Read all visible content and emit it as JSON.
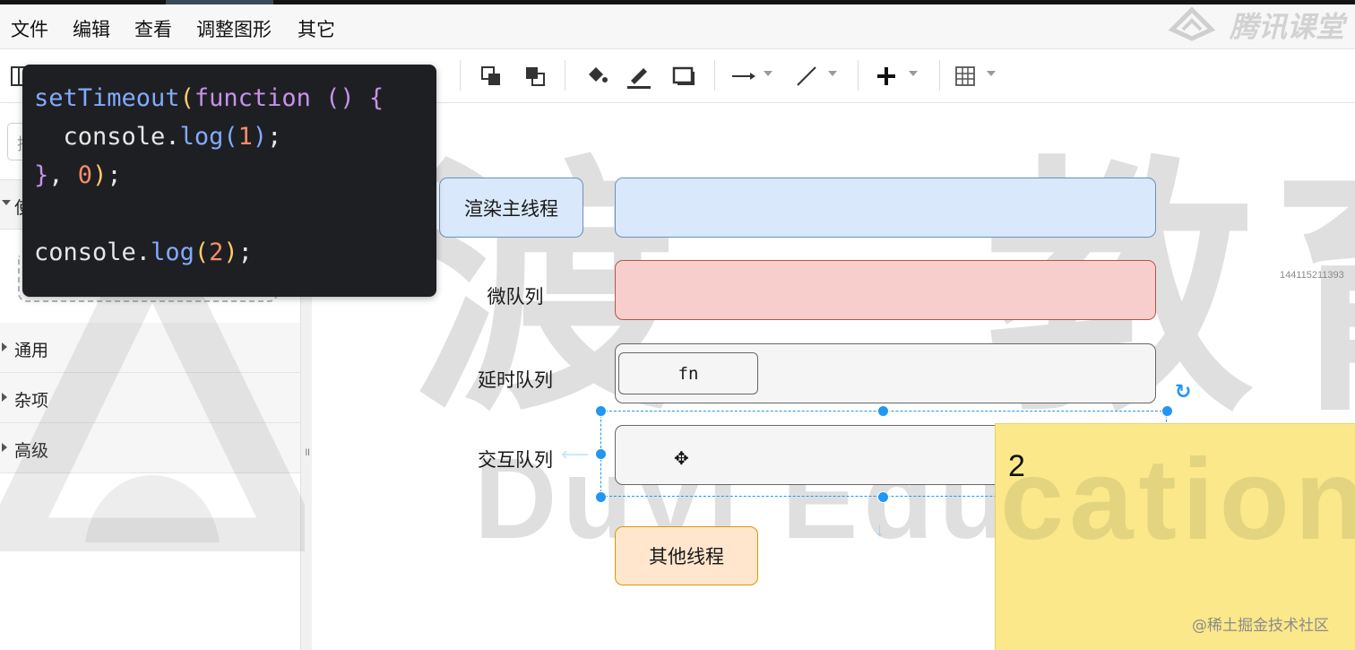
{
  "menubar": {
    "items": [
      "文件",
      "编辑",
      "查看",
      "调整图形",
      "其它"
    ]
  },
  "toolbar": {
    "icons": [
      "layout-icon",
      "to-front-icon",
      "to-back-icon",
      "fill-color-icon",
      "line-color-icon",
      "shadow-icon",
      "connection-arrow-icon",
      "waypoint-icon",
      "insert-plus-icon",
      "table-icon"
    ]
  },
  "sidebar": {
    "search_placeholder": "搜",
    "partial_section": "使",
    "sections": [
      "通用",
      "杂项",
      "高级"
    ]
  },
  "code": {
    "lines": [
      [
        "setTimeout",
        "(",
        "function",
        " ",
        "()",
        " ",
        "{"
      ],
      [
        "  console",
        ".",
        "log",
        "(",
        "1",
        ")",
        ";"
      ],
      [
        "}",
        ",",
        " ",
        "0",
        ")",
        ";"
      ],
      [
        ""
      ],
      [
        "console",
        ".",
        "log",
        "(",
        "2",
        ")",
        ";"
      ]
    ]
  },
  "diagram": {
    "render_main_thread": "渲染主线程",
    "micro_queue": "微队列",
    "delay_queue": "延时队列",
    "delay_task": "fn",
    "interaction_queue": "交互队列",
    "other_threads": "其他线程"
  },
  "sticky": {
    "text": "2"
  },
  "watermark": {
    "brand_cn": "渡一教育",
    "brand_en": "Duyi Education",
    "tencent": "腾讯课堂",
    "id_text": "144115211393"
  },
  "credit": "@稀土掘金技术社区",
  "colors": {
    "render_fill": "#dae8fc",
    "render_stroke": "#6c8ebf",
    "micro_fill": "#f8cecc",
    "micro_stroke": "#b85450",
    "other_fill": "#ffe6cc",
    "other_stroke": "#d79b00",
    "handle": "#2196f3",
    "sticky": "#fbe88a"
  }
}
